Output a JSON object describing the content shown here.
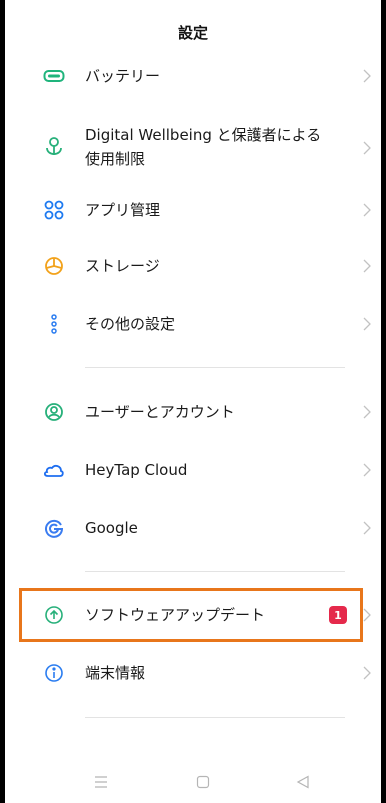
{
  "header": {
    "title": "設定"
  },
  "items": [
    {
      "label": "バッテリー",
      "icon": "battery-icon"
    },
    {
      "label_line1": "Digital Wellbeing と保護者による",
      "label_line2": "使用制限",
      "icon": "wellbeing-icon"
    },
    {
      "label": "アプリ管理",
      "icon": "app-management-icon"
    },
    {
      "label": "ストレージ",
      "icon": "storage-icon"
    },
    {
      "label": "その他の設定",
      "icon": "more-settings-icon"
    },
    {
      "label": "ユーザーとアカウント",
      "icon": "user-accounts-icon"
    },
    {
      "label": "HeyTap Cloud",
      "icon": "cloud-icon"
    },
    {
      "label": "Google",
      "icon": "google-icon"
    },
    {
      "label": "ソフトウェアアップデート",
      "icon": "software-update-icon",
      "badge": "1"
    },
    {
      "label": "端末情報",
      "icon": "info-icon"
    }
  ],
  "colors": {
    "battery": "#1fb47c",
    "wellbeing": "#27b07a",
    "apps": "#1e7af0",
    "storage": "#f2a21b",
    "more": "#2a7cf0",
    "user": "#27b07a",
    "cloud": "#1e6ef0",
    "google": "#3a7cf0",
    "update": "#27b07a",
    "info": "#2a7cf0",
    "badge": "#e5294b",
    "highlight": "#e8761b"
  },
  "navbar": {
    "icons": [
      "menu-icon",
      "home-icon",
      "back-icon"
    ]
  }
}
